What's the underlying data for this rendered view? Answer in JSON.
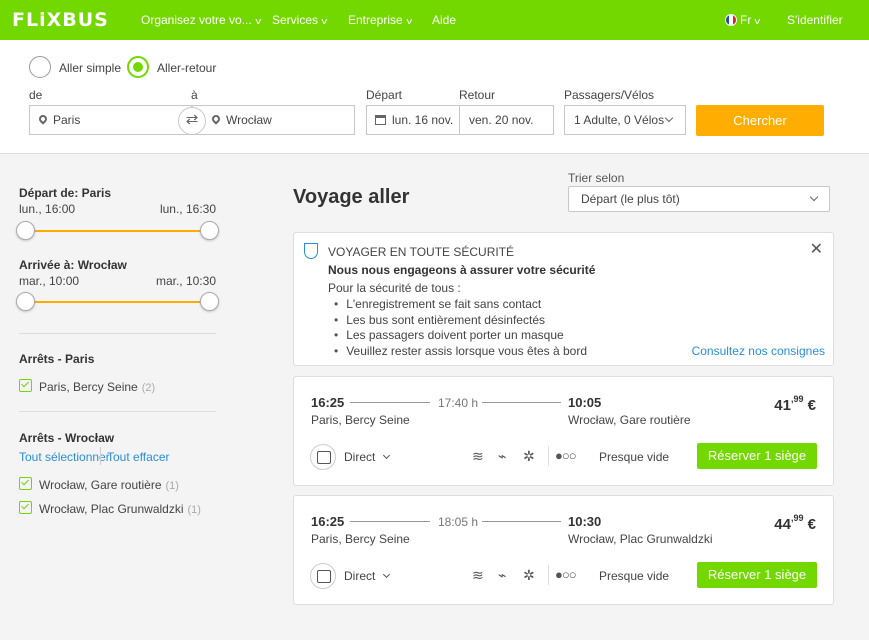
{
  "nav": {
    "logo": "FLiXBUS",
    "links": [
      "Organisez votre vo...",
      "Services",
      "Entreprise",
      "Aide"
    ],
    "language": "Fr",
    "signin": "S'identifier"
  },
  "search": {
    "trip_types": [
      "Aller simple",
      "Aller-retour"
    ],
    "selected_trip_type": "Aller-retour",
    "from_label": "de",
    "to_label": "à",
    "from_value": "Paris",
    "to_value": "Wrocław",
    "depart_label": "Départ",
    "return_label": "Retour",
    "depart_value": "lun. 16 nov.",
    "return_value": "ven. 20 nov.",
    "passengers_label": "Passagers/Vélos",
    "passengers_value": "1 Adulte, 0 Vélos",
    "search_button": "Chercher"
  },
  "filters": {
    "departure": {
      "title": "Départ de: Paris",
      "min": "lun., 16:00",
      "max": "lun., 16:30"
    },
    "arrival": {
      "title": "Arrivée à: Wrocław",
      "min": "mar., 10:00",
      "max": "mar., 10:30"
    },
    "stops_from": {
      "title": "Arrêts - Paris",
      "items": [
        {
          "label": "Paris, Bercy Seine",
          "count": "(2)"
        }
      ]
    },
    "stops_to": {
      "title": "Arrêts - Wrocław",
      "select_all": "Tout sélectionner",
      "clear_all": "Tout effacer",
      "items": [
        {
          "label": "Wrocław, Gare routière",
          "count": "(1)"
        },
        {
          "label": "Wrocław, Plac Grunwaldzki",
          "count": "(1)"
        }
      ]
    }
  },
  "results": {
    "heading": "Voyage aller",
    "sort_label": "Trier selon",
    "sort_value": "Départ (le plus tôt)",
    "safety": {
      "title": "VOYAGER EN TOUTE SÉCURITÉ",
      "subtitle": "Nous nous engageons à assurer votre sécurité",
      "intro": "Pour la sécurité de tous :",
      "points": [
        "L'enregistrement se fait sans contact",
        "Les bus sont entièrement désinfectés",
        "Les passagers doivent porter un masque",
        "Veuillez rester assis lorsque vous êtes à bord"
      ],
      "link": "Consultez nos consignes"
    },
    "trips": [
      {
        "dep_time": "16:25",
        "dep_station": "Paris, Bercy Seine",
        "duration": "17:40 h",
        "arr_time": "10:05",
        "arr_station": "Wrocław, Gare routière",
        "price_main": "41",
        "price_cents": ",99",
        "currency": " €",
        "type": "Direct",
        "occupancy": "Presque vide",
        "reserve": "Réserver 1 siège"
      },
      {
        "dep_time": "16:25",
        "dep_station": "Paris, Bercy Seine",
        "duration": "18:05 h",
        "arr_time": "10:30",
        "arr_station": "Wrocław, Plac Grunwaldzki",
        "price_main": "44",
        "price_cents": ",99",
        "currency": " €",
        "type": "Direct",
        "occupancy": "Presque vide",
        "reserve": "Réserver 1 siège"
      }
    ]
  },
  "colors": {
    "brand": "#73d700",
    "accent": "#ffad00",
    "link": "#2a8ed8"
  }
}
